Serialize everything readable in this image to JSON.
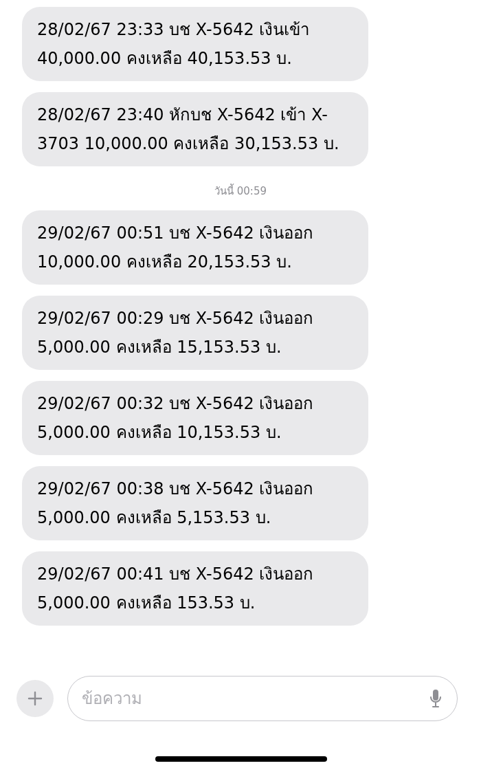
{
  "thread": [
    {
      "kind": "message",
      "text": "28/02/67 23:33 บช X-5642 เงินเข้า 40,000.00 คงเหลือ 40,153.53 บ."
    },
    {
      "kind": "message",
      "text": "28/02/67 23:40 หักบช X-5642 เข้า X-3703 10,000.00 คงเหลือ 30,153.53 บ."
    },
    {
      "kind": "timestamp",
      "text": "วันนี้ 00:59"
    },
    {
      "kind": "message",
      "text": "29/02/67 00:51 บช X-5642 เงินออก 10,000.00 คงเหลือ 20,153.53 บ."
    },
    {
      "kind": "message",
      "text": "29/02/67 00:29 บช X-5642 เงินออก 5,000.00 คงเหลือ 15,153.53 บ."
    },
    {
      "kind": "message",
      "text": "29/02/67 00:32 บช X-5642 เงินออก 5,000.00 คงเหลือ 10,153.53 บ."
    },
    {
      "kind": "message",
      "text": "29/02/67 00:38 บช X-5642 เงินออก 5,000.00 คงเหลือ 5,153.53 บ."
    },
    {
      "kind": "message",
      "text": "29/02/67 00:41 บช X-5642 เงินออก 5,000.00 คงเหลือ 153.53 บ."
    }
  ],
  "composer": {
    "placeholder": "ข้อความ"
  }
}
